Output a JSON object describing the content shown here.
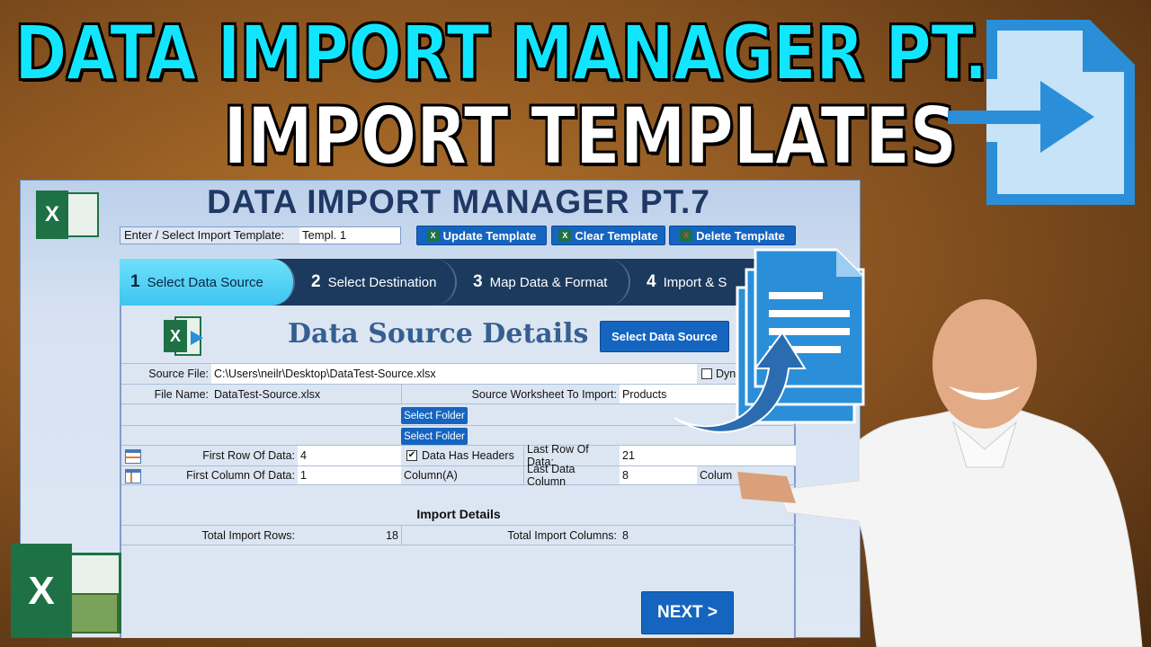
{
  "thumbnail": {
    "headline1": "DATA IMPORT MANAGER PT. 7",
    "headline2": "IMPORT TEMPLATES"
  },
  "app": {
    "title": "DATA IMPORT MANAGER PT.7",
    "template": {
      "label": "Enter / Select Import Template:",
      "value": "Templ. 1"
    },
    "toolbar": {
      "update": "Update Template",
      "clear": "Clear Template",
      "delete": "Delete Template"
    },
    "steps": [
      {
        "num": "1",
        "label": "Select Data Source",
        "active": true
      },
      {
        "num": "2",
        "label": "Select Destination"
      },
      {
        "num": "3",
        "label": "Map Data & Format"
      },
      {
        "num": "4",
        "label": "Import & S"
      }
    ],
    "section_title": "Data Source Details",
    "select_source": "Select Data Source",
    "source_file": {
      "label": "Source File:",
      "value": "C:\\Users\\neilr\\Desktop\\DataTest-Source.xlsx",
      "dyn": "Dyn"
    },
    "file_name": {
      "label": "File Name:",
      "value": "DataTest-Source.xlsx"
    },
    "worksheet": {
      "label": "Source Worksheet To Import:",
      "value": "Products"
    },
    "select_folder": "Select Folder",
    "first_row": {
      "label": "First Row Of Data:",
      "value": "4"
    },
    "has_headers": {
      "label": "Data Has Headers",
      "checked": true
    },
    "last_row": {
      "label": "Last Row Of Data:",
      "value": "21"
    },
    "first_col": {
      "label": "First Column Of Data:",
      "value": "1",
      "col": "Column(A)"
    },
    "last_col": {
      "label": "Last Data Column",
      "value": "8",
      "col": "Colum"
    },
    "import_details": "Import Details",
    "total_rows": {
      "label": "Total Import Rows:",
      "value": "18"
    },
    "total_cols": {
      "label": "Total  Import Columns:",
      "value": "8"
    },
    "next": "NEXT >"
  },
  "colors": {
    "cyan": "#12e6ff",
    "navy": "#1f3864",
    "button": "#1565c0",
    "excel": "#1e7145"
  }
}
